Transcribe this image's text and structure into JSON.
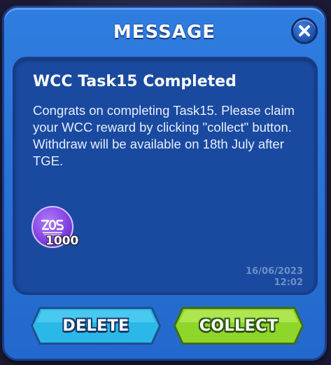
{
  "dialog": {
    "title": "MESSAGE"
  },
  "message": {
    "title": "WCC Task15 Completed",
    "body": "Congrats on completing Task15. Please claim your WCC reward by clicking \"collect\" button. Withdraw will be available on 18th July after TGE.",
    "reward_amount": "1000",
    "reward_icon": "wcc-token-icon",
    "date": "16/06/2023",
    "time": "12:02"
  },
  "buttons": {
    "delete_label": "DELETE",
    "collect_label": "COLLECT"
  },
  "colors": {
    "dialog_blue": "#2368cc",
    "panel_blue": "#1a4aa0",
    "delete_cyan": "#2ab8e8",
    "collect_green": "#8fd62a",
    "token_purple": "#7f3ee0"
  }
}
